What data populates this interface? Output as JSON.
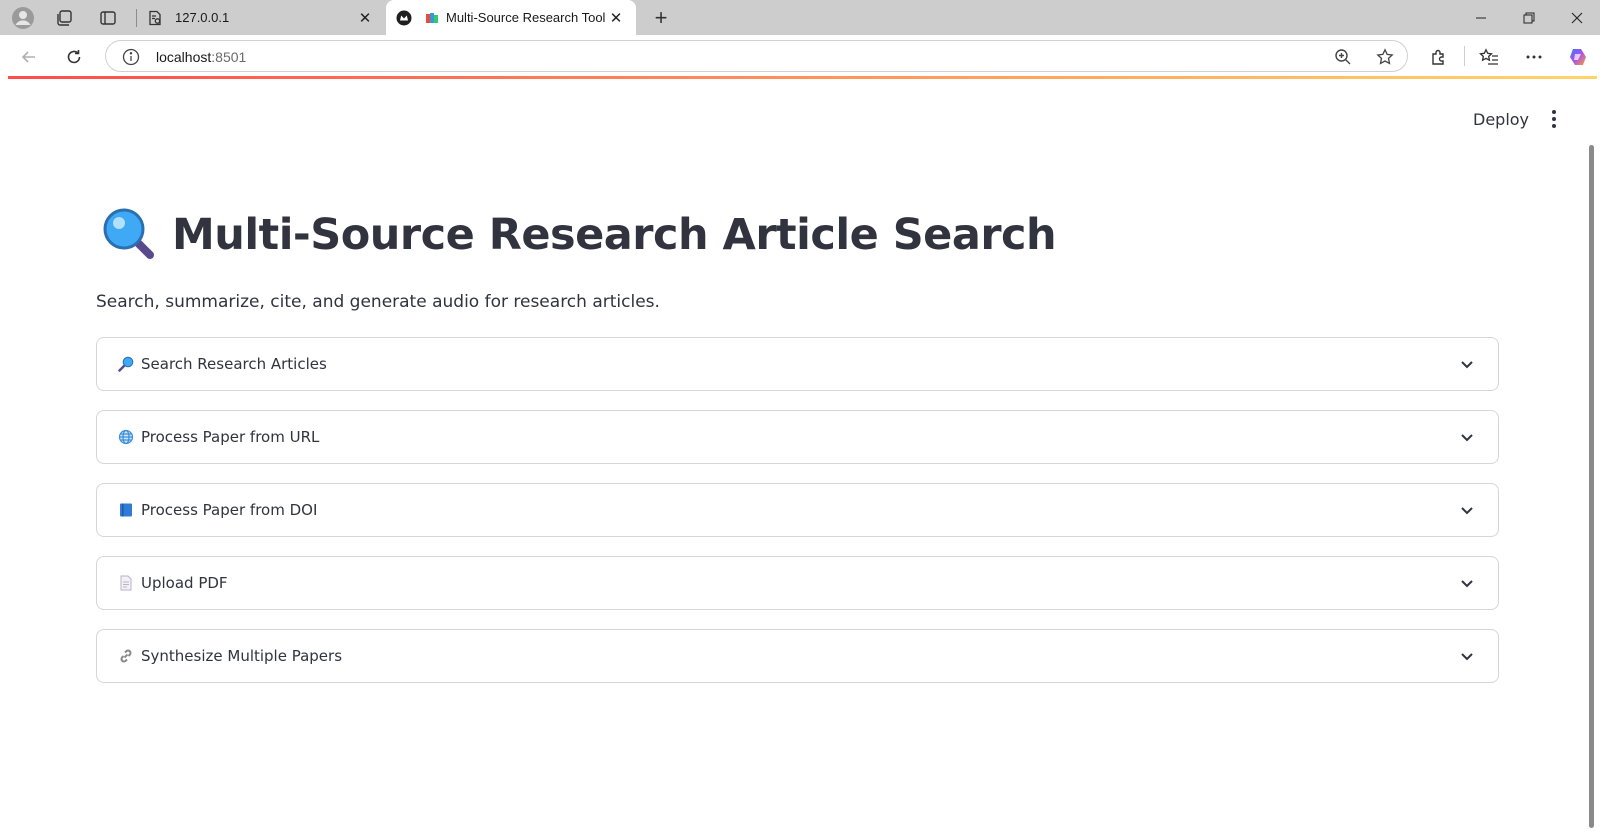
{
  "browser": {
    "tabs": [
      {
        "title": "127.0.0.1",
        "active": false
      },
      {
        "title": "Multi-Source Research Tool",
        "active": true
      }
    ],
    "address": {
      "host": "localhost",
      "port": ":8501"
    }
  },
  "header": {
    "deploy_label": "Deploy"
  },
  "main": {
    "title": "Multi-Source Research Article Search",
    "subtitle": "Search, summarize, cite, and generate audio for research articles.",
    "expanders": [
      {
        "label": "Search Research Articles",
        "icon": "magnifier-tilted-right-icon"
      },
      {
        "label": "Process Paper from URL",
        "icon": "globe-icon"
      },
      {
        "label": "Process Paper from DOI",
        "icon": "blue-book-icon"
      },
      {
        "label": "Upload PDF",
        "icon": "page-icon"
      },
      {
        "label": "Synthesize Multiple Papers",
        "icon": "link-icon"
      }
    ]
  },
  "colors": {
    "text": "#31333f",
    "accent_gradient_start": "#ff4b4b",
    "accent_gradient_end": "#ffd56b",
    "border": "#d6d6d9"
  }
}
